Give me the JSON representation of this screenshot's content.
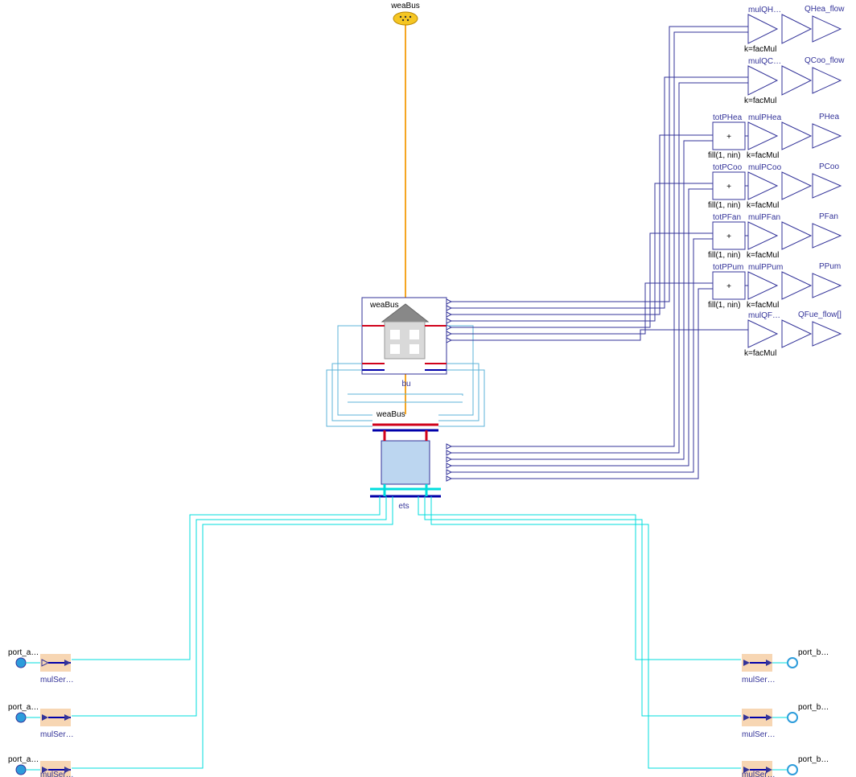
{
  "top": {
    "weaBus": "weaBus"
  },
  "building": {
    "label": "bu",
    "weaBus": "weaBus"
  },
  "ets": {
    "label": "ets",
    "weaBus": "weaBus"
  },
  "outputs": {
    "QHea_flow": "QHea_flow",
    "QCoo_flow": "QCoo_flow",
    "PHea": "PHea",
    "PCoo": "PCoo",
    "PFan": "PFan",
    "PPum": "PPum",
    "QFue_flow": "QFue_flow[]"
  },
  "blocks": {
    "mulQH": {
      "name": "mulQH…",
      "k": "k=facMul"
    },
    "mulQC": {
      "name": "mulQC…",
      "k": "k=facMul"
    },
    "totPHea": {
      "name": "totPHea",
      "fill": "fill(1, nin)",
      "plus": "+"
    },
    "mulPHea": {
      "name": "mulPHea",
      "k": "k=facMul"
    },
    "totPCoo": {
      "name": "totPCoo",
      "fill": "fill(1, nin)",
      "plus": "+"
    },
    "mulPCoo": {
      "name": "mulPCoo",
      "k": "k=facMul"
    },
    "totPFan": {
      "name": "totPFan",
      "fill": "fill(1, nin)",
      "plus": "+"
    },
    "mulPFan": {
      "name": "mulPFan",
      "k": "k=facMul"
    },
    "totPPum": {
      "name": "totPPum",
      "fill": "fill(1, nin)",
      "plus": "+"
    },
    "mulPPum": {
      "name": "mulPPum",
      "k": "k=facMul"
    },
    "mulQF": {
      "name": "mulQF…",
      "k": "k=facMul"
    }
  },
  "ports": {
    "a": {
      "label": "port_a…",
      "mul": "mulSer…"
    },
    "b": {
      "label": "port_b…",
      "mul": "mulSer…"
    }
  }
}
